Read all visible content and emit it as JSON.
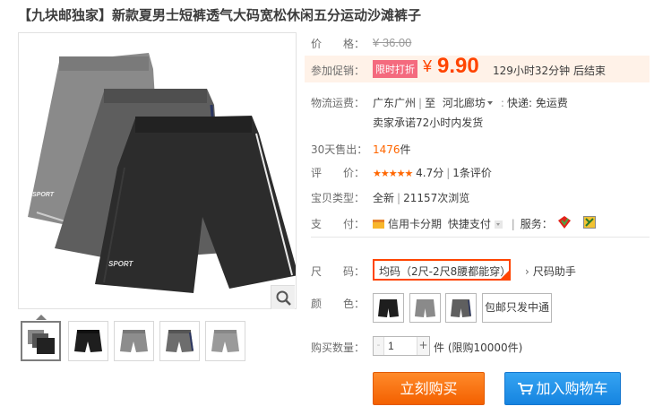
{
  "product": {
    "title_tag": "【九块邮独家】",
    "title_text": "新款夏男士短裤透气大码宽松休闲五分运动沙滩裤子"
  },
  "price": {
    "label": "价　　格：",
    "original": "¥ 36.00",
    "promo_label": "参加促销：",
    "promo_tag": "限时打折",
    "symbol": "¥",
    "current": "9.90",
    "countdown": "129小时32分钟 后结束"
  },
  "shipping": {
    "label": "物流运费：",
    "origin": "广东广州",
    "to": "至",
    "destination": "河北廊坊",
    "fee": "快递: 免运费",
    "promise": "卖家承诺72小时内发货"
  },
  "sales": {
    "label": "30天售出：",
    "count": "1476",
    "unit": "件"
  },
  "rating": {
    "label": "评　　价：",
    "stars": "★★★★★",
    "score": "4.7分",
    "reviews": "1条评价"
  },
  "item_type": {
    "label": "宝贝类型：",
    "condition": "全新",
    "views": "21157次浏览"
  },
  "payment": {
    "label": "支　　付：",
    "installment": "信用卡分期",
    "quick_pay": "快捷支付",
    "service_label": "服务："
  },
  "size": {
    "label": "尺　　码：",
    "selected": "均码（2尺-2尺8腰都能穿）",
    "helper": "尺码助手"
  },
  "color": {
    "label": "颜　　色：",
    "text_option": "包邮只发中通"
  },
  "quantity": {
    "label": "购买数量：",
    "minus": "-",
    "value": "1",
    "plus": "+",
    "suffix": "件 (限购10000件)"
  },
  "actions": {
    "buy": "立刻购买",
    "cart": "加入购物车"
  },
  "colors": {
    "price": "#ff4400",
    "buy_button": "#f36000",
    "cart_button": "#1684e0",
    "promo_tag": "#f46a7e"
  }
}
